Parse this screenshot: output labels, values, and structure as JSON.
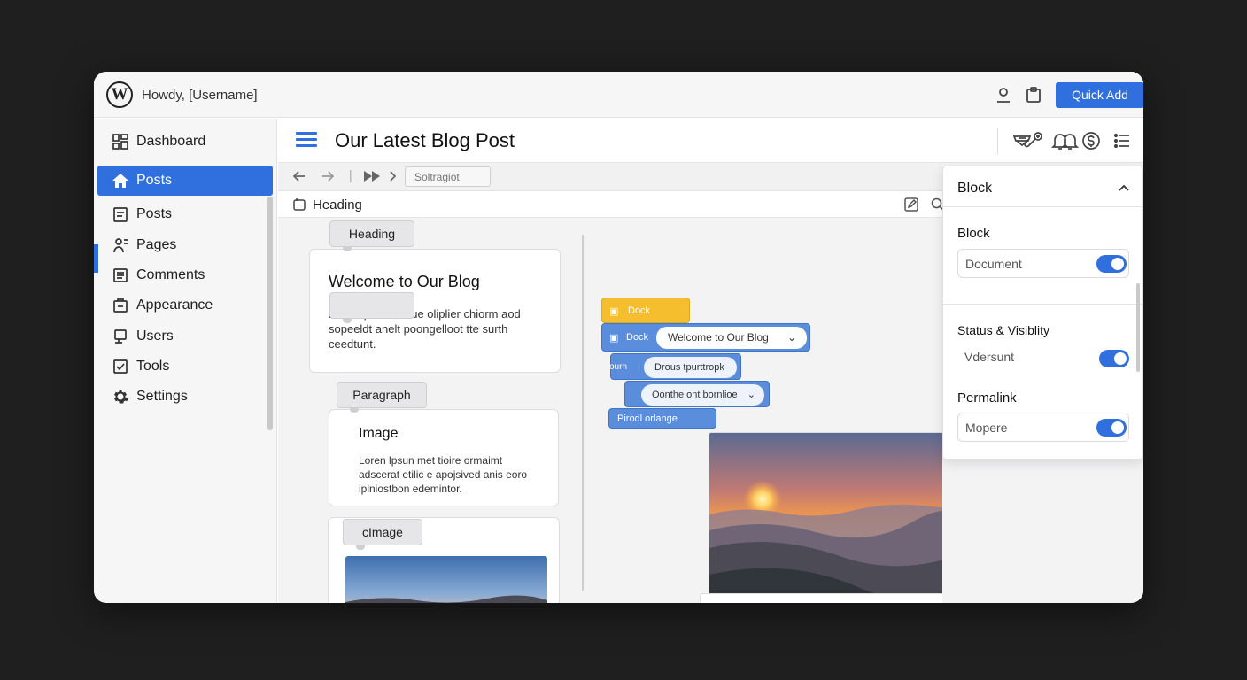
{
  "admin_bar": {
    "logo": "W",
    "greeting": "Howdy, [Username]",
    "quick_add_label": "Quick Add",
    "icons": [
      "user-icon",
      "clipboard-icon"
    ]
  },
  "sidebar": {
    "items": [
      {
        "label": "Dashboard",
        "icon": "dashboard-icon"
      },
      {
        "label": "Posts",
        "icon": "home-icon",
        "active": true
      },
      {
        "label": "Posts",
        "icon": "post-icon"
      },
      {
        "label": "Pages",
        "icon": "pages-icon"
      },
      {
        "label": "Comments",
        "icon": "comments-icon"
      },
      {
        "label": "Appearance",
        "icon": "appearance-icon"
      },
      {
        "label": "Users",
        "icon": "users-icon"
      },
      {
        "label": "Tools",
        "icon": "tools-icon"
      },
      {
        "label": "Settings",
        "icon": "gear-icon"
      }
    ]
  },
  "editor": {
    "title": "Our Latest Blog Post",
    "header_icons": [
      "link-icon",
      "bell-icon",
      "inbox-icon",
      "bell-icon",
      "dollar-icon",
      "list-icon"
    ],
    "toolbar": {
      "search_placeholder": "Soltragiot"
    },
    "breadcrumb": "Heading"
  },
  "canvas": {
    "blocks": [
      {
        "tag": "Heading",
        "title": "Welcome to Our Blog",
        "body": "Loren ipoum diaue oliplier chiorm aod sopeeldt anelt poongelloot tte surth ceedtunt."
      },
      {
        "tag": "Paragraph",
        "title": "Image",
        "body": "Loren lpsun met tioire ormaimt adscerat etilic e apojsived anis eoro iplniostbon edemintor."
      },
      {
        "tag": "cImage"
      }
    ],
    "scratch": {
      "top_label": "Dock",
      "dock_label": "Dock",
      "dock_value": "Welcome to Our Blog",
      "row2_prefix": "ourn",
      "row2_value": "Drous tpurttropk",
      "row3_value": "Oonthe ont bornlioe",
      "row4_label": "Pirodl orlange"
    }
  },
  "panel": {
    "title": "Block",
    "sections": {
      "block_label": "Block",
      "document_value": "Document",
      "status_label": "Status & Visiblity",
      "status_value": "Vdersunt",
      "permalink_label": "Permalink",
      "permalink_value": "Mopere"
    }
  },
  "colors": {
    "accent": "#2f6fde",
    "scratch_yellow": "#f4be2e",
    "scratch_blue": "#5a8ddc"
  }
}
